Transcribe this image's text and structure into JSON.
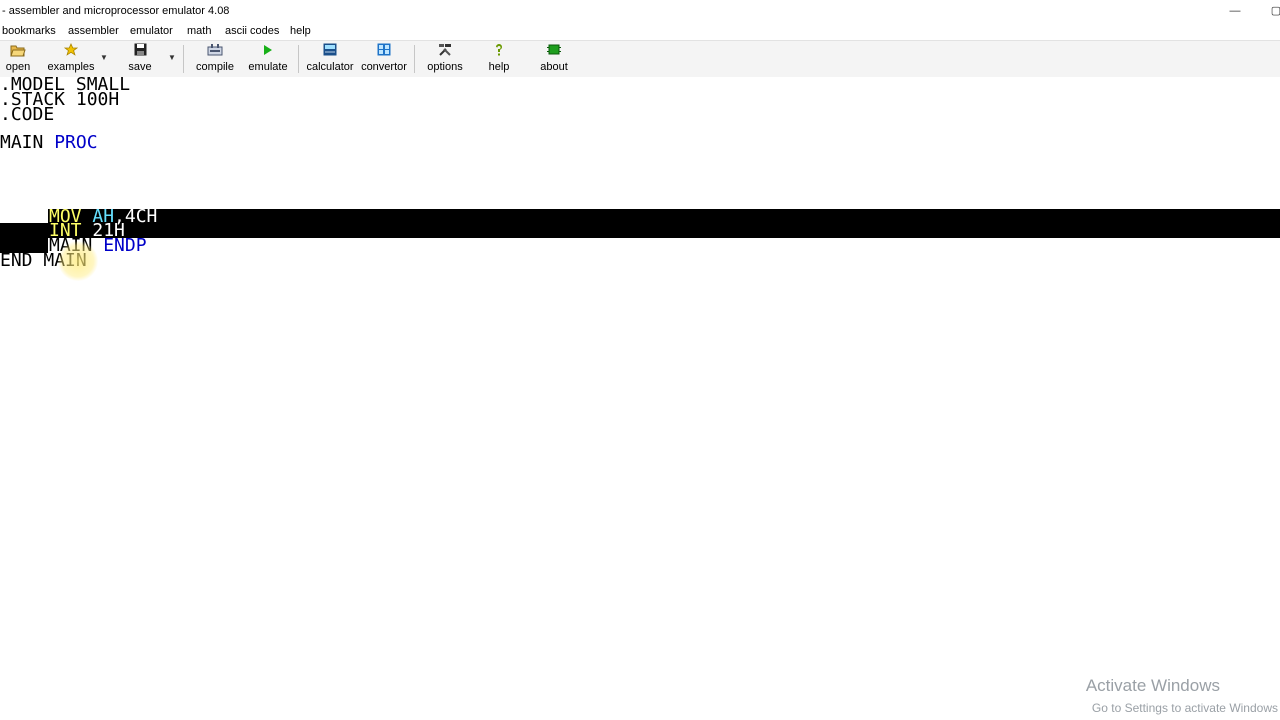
{
  "window": {
    "title": "- assembler and microprocessor emulator 4.08",
    "minimize_glyph": "—",
    "maximize_glyph": "▢"
  },
  "menu": {
    "items": [
      "bookmarks",
      "assembler",
      "emulator",
      "math",
      "ascii codes",
      "help"
    ]
  },
  "toolbar": {
    "open": {
      "label": "open",
      "icon": "folder-open-icon"
    },
    "examples": {
      "label": "examples",
      "icon": "star-icon"
    },
    "save": {
      "label": "save",
      "icon": "floppy-disk-icon"
    },
    "compile": {
      "label": "compile",
      "icon": "compile-icon"
    },
    "emulate": {
      "label": "emulate",
      "icon": "play-icon"
    },
    "calculator": {
      "label": "calculator",
      "icon": "calculator-icon"
    },
    "convertor": {
      "label": "convertor",
      "icon": "convertor-icon"
    },
    "options": {
      "label": "options",
      "icon": "tools-icon"
    },
    "help": {
      "label": "help",
      "icon": "question-icon"
    },
    "about": {
      "label": "about",
      "icon": "chip-icon"
    },
    "dropdown_glyph": "▼"
  },
  "code": {
    "line1": ".MODEL SMALL",
    "line2": ".STACK 100H",
    "line3": ".CODE",
    "line5_ident": "MAIN",
    "line5_kw": "PROC",
    "sel1_mov": "MOV",
    "sel1_reg": "AH",
    "sel1_val": ",4CH",
    "sel2_int": "INT",
    "sel2_val": "21H",
    "sel3_ident": "MAIN",
    "sel3_kw": "ENDP",
    "last_end": "END",
    "last_ident": "MAIN"
  },
  "watermark": {
    "line1": "Activate Windows",
    "line2": "Go to Settings to activate Windows"
  },
  "colors": {
    "keyword": "#0000c8",
    "selection_background": "#000000",
    "selected_instruction": "#ffff66",
    "selected_register": "#66e0ff"
  }
}
